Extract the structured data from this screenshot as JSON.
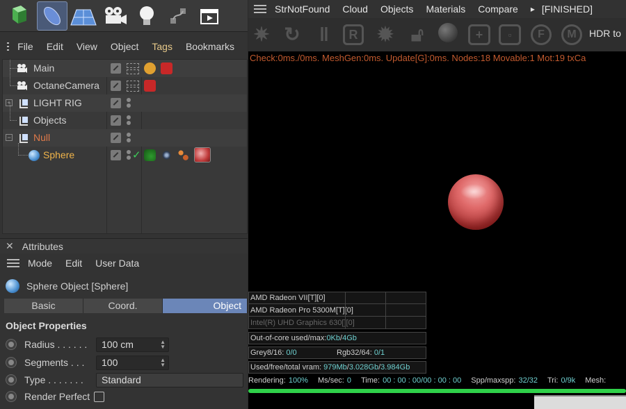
{
  "object_manager": {
    "menu": [
      "File",
      "Edit",
      "View",
      "Object",
      "Tags",
      "Bookmarks"
    ],
    "objects": [
      {
        "name": "Main",
        "color": "#d0d0d0"
      },
      {
        "name": "OctaneCamera",
        "color": "#d0d0d0"
      },
      {
        "name": "LIGHT RIG",
        "color": "#d0d0d0"
      },
      {
        "name": "Objects",
        "color": "#d0d0d0"
      },
      {
        "name": "Null",
        "color": "#e07a4a"
      },
      {
        "name": "Sphere",
        "color": "#f0b44a"
      }
    ]
  },
  "attributes": {
    "title": "Attributes",
    "menu": [
      "Mode",
      "Edit",
      "User Data"
    ],
    "object_title": "Sphere Object [Sphere]",
    "tabs": [
      "Basic",
      "Coord.",
      "Object"
    ],
    "active_tab": "Object",
    "section": "Object Properties",
    "props": {
      "radius_label": "Radius . . . . . .",
      "radius_value": "100 cm",
      "segments_label": "Segments . . .",
      "segments_value": "100",
      "type_label": "Type . . . . . . .",
      "type_value": "Standard",
      "render_perfect_label": "Render Perfect"
    }
  },
  "render_viewer": {
    "menu": [
      "StrNotFound",
      "Cloud",
      "Objects",
      "Materials",
      "Compare"
    ],
    "arrow": "▸",
    "state": "[FINISHED]",
    "hdr_label": "HDR to",
    "status_line": "Check:0ms./0ms. MeshGen:0ms. Update[G]:0ms. Nodes:18 Movable:1 Mot:19 txCa",
    "devices": [
      {
        "name": "AMD Radeon VII[T][0]",
        "dim": false
      },
      {
        "name": "AMD Radeon Pro 5300M[T][0]",
        "dim": false
      },
      {
        "name": "Intel(R) UHD Graphics 630[][0]",
        "dim": true
      }
    ],
    "ooc_label": "Out-of-core used/max:",
    "ooc_used": "0Kb",
    "ooc_sep": "/",
    "ooc_max": "4Gb",
    "grey_label": "Grey8/16:",
    "grey_value": "0/0",
    "rgb_label": "Rgb32/64:",
    "rgb_value": "0/1",
    "vram_label": "Used/free/total vram:",
    "vram_used": "979Mb",
    "vram_free": "3.028Gb",
    "vram_total": "3.984Gb",
    "vram_sep": "/",
    "bottom": {
      "rendering_label": "Rendering:",
      "rendering_value": "100%",
      "ms_label": "Ms/sec:",
      "ms_value": "0",
      "time_label": "Time:",
      "time_value": "00 : 00 : 00/00 : 00 : 00",
      "spp_label": "Spp/maxspp:",
      "spp_value": "32/32",
      "tri_label": "Tri:",
      "tri_value": "0/9k",
      "mesh_label": "Mesh:"
    },
    "progress": 1.0
  },
  "colors": {
    "accent_tab": "#6b86b8",
    "status_orange": "#c25a2e",
    "value_cyan": "#6fd0d0",
    "progress_green": "#2fd14a"
  }
}
